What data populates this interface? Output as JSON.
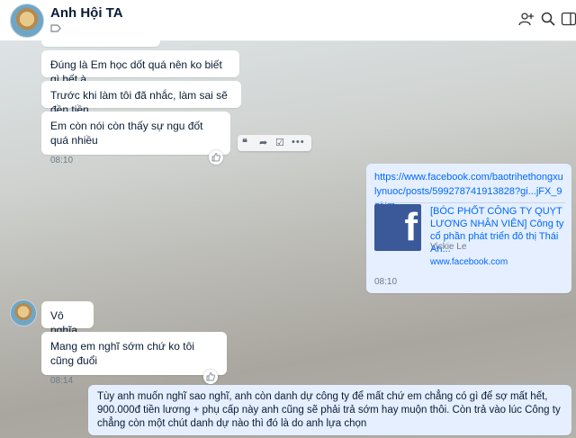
{
  "header": {
    "title": "Anh Hội TA"
  },
  "messages": [
    {
      "text": "Đúng là Em học dốt quá nên ko biết gì hết à"
    },
    {
      "text": "Trước khi làm tôi đã nhắc, làm sai sẽ đền tiền"
    },
    {
      "text": "Em còn nói còn thấy sự ngu đốt quá nhiều",
      "time": "08:10"
    },
    {
      "link_url": "https://www.facebook.com/baotrihethongxulynuoc/posts/599278741913828?gi...jFX_9qNm",
      "preview_title": "[BÓC PHỐT CÔNG TY QUỴT LƯƠNG NHÂN VIÊN] Công ty cổ phần phát triển đô thị Thái An...",
      "preview_author": "Vickie Le",
      "preview_domain": "www.facebook.com",
      "time": "08:10"
    },
    {
      "text": "Vô nghĩa"
    },
    {
      "text": "Mang em nghĩ sớm chứ ko tôi cũng đuổi",
      "time": "08:14"
    },
    {
      "text": "Tùy anh muốn nghĩ sao nghĩ, anh còn danh dự công ty để mất chứ em chẳng có gì để sợ mất hết, 900.000đ tiền lương + phụ cấp này anh cũng sẽ phải trả sớm hay muộn thôi. Còn trả vào lúc Công ty chẳng còn một chút danh dự nào thì đó là do anh lựa chọn"
    }
  ]
}
